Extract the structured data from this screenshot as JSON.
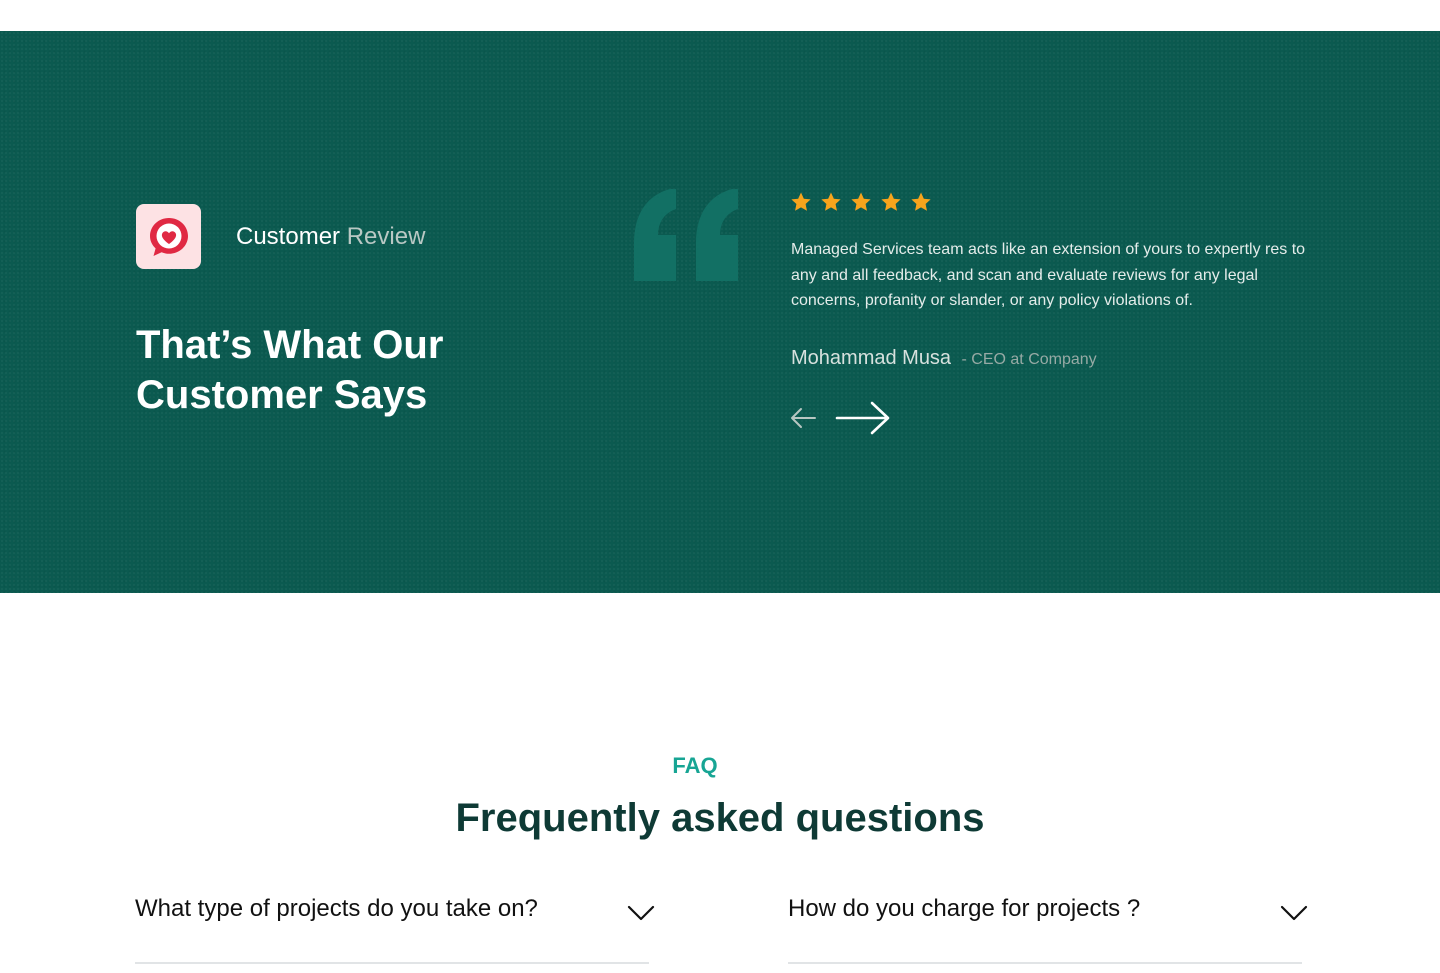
{
  "review": {
    "eyebrow_primary": "Customer",
    "eyebrow_secondary": "Review",
    "title": "That’s What Our Customer Says",
    "rating": 5,
    "text": "Managed Services team acts like an extension of yours to expertly res to any and all feedback, and scan and evaluate reviews for any legal concerns, profanity or slander, or any policy violations of.",
    "author_name": "Mohammad Musa",
    "author_role": "- CEO at Company",
    "icons": {
      "badge": "heart-chat-icon",
      "quote": "quote-mark-icon",
      "star": "star-icon",
      "prev": "arrow-left-icon",
      "next": "arrow-right-icon"
    },
    "colors": {
      "background": "#0b5a50",
      "star": "#f7a41c",
      "badge_bg": "#fde2e4",
      "badge_icon": "#e02943"
    }
  },
  "faq": {
    "eyebrow": "FAQ",
    "title": "Frequently asked questions",
    "items": [
      {
        "question": "What type of projects do you take on?",
        "expanded": false
      },
      {
        "question": "How do you charge for projects ?",
        "expanded": false
      }
    ],
    "colors": {
      "accent": "#17a594",
      "title": "#0e3a35"
    }
  }
}
